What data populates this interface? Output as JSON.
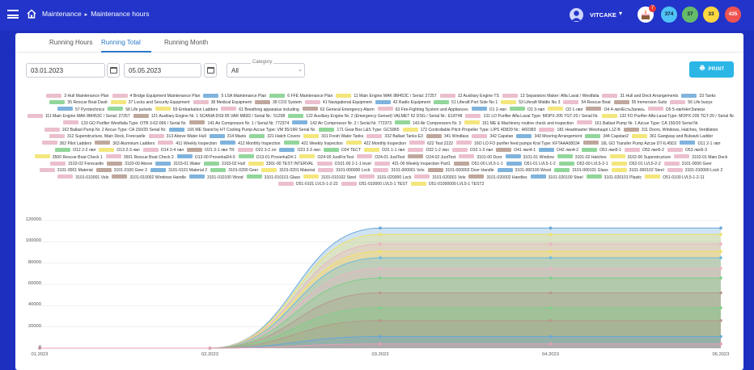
{
  "breadcrumb": {
    "section": "Maintenance",
    "separator": "▸",
    "page": "Maintenance hours"
  },
  "user": {
    "name": "VITCAKE",
    "cake_badge": "7"
  },
  "counters": [
    {
      "value": "374",
      "bg": "#4fc3f7",
      "fg": "#123"
    },
    {
      "value": "37",
      "bg": "#66bb6a",
      "fg": "#123"
    },
    {
      "value": "33",
      "bg": "#ffd740",
      "fg": "#123"
    },
    {
      "value": "435",
      "bg": "#ef5350",
      "fg": "#fff"
    }
  ],
  "tabs": [
    "Running Hours",
    "Running Total",
    "Running Month"
  ],
  "active_tab": "Running Total",
  "filters": {
    "date_from": "03.01.2023",
    "date_to": "05.05.2023",
    "category_label": "Category",
    "category_value": "All"
  },
  "print_label": "PRINT",
  "colors": {
    "topbar": "#2234c9",
    "accent": "#2a78c8",
    "print": "#2bb6e6"
  },
  "chart_data": {
    "type": "area",
    "x": [
      "01.2023",
      "02.2023",
      "03.2023",
      "04.2023",
      "05.2023"
    ],
    "ylim": [
      0,
      120000
    ],
    "yticks": [
      "120000",
      "100000",
      "80000",
      "60000",
      "40000",
      "20000",
      "0"
    ],
    "series_shown": [
      {
        "values": [
          0,
          0,
          113000,
          113000,
          113000
        ],
        "color": "#6aa7d8"
      },
      {
        "values": [
          0,
          0,
          107000,
          107000,
          107000
        ],
        "color": "#f2e266"
      },
      {
        "values": [
          0,
          0,
          98000,
          98000,
          98000
        ],
        "color": "#e8b4c4"
      },
      {
        "values": [
          0,
          0,
          91000,
          91000,
          91000
        ],
        "color": "#f2e266"
      },
      {
        "values": [
          0,
          0,
          85000,
          85000,
          85000
        ],
        "color": "#6bbce0"
      },
      {
        "values": [
          0,
          0,
          75000,
          75000,
          75000
        ],
        "color": "#e8b4c4"
      },
      {
        "values": [
          0,
          0,
          66000,
          66000,
          66000
        ],
        "color": "#7fd08a"
      },
      {
        "values": [
          0,
          0,
          52000,
          52000,
          52000
        ],
        "color": "#b59a8c"
      },
      {
        "values": [
          0,
          0,
          38000,
          38000,
          38000
        ],
        "color": "#7fd08a"
      },
      {
        "values": [
          0,
          0,
          26000,
          26000,
          26000
        ],
        "color": "#b59a8c"
      },
      {
        "values": [
          0,
          0,
          11000,
          11000,
          11000
        ],
        "color": "#6aa7d8"
      },
      {
        "values": [
          0,
          0,
          4000,
          4000,
          4000
        ],
        "color": "#e8a0b4"
      }
    ],
    "legend": [
      {
        "label": "3 Hull Maintenance Plan",
        "color": "#e8b4c4"
      },
      {
        "label": "4 Bridge Equipment Maintenance Plan",
        "color": "#e8b4c4"
      },
      {
        "label": "5 LSA Maintenance Plan",
        "color": "#6aa7d8"
      },
      {
        "label": "6 FFE Maintenance Plan",
        "color": "#7fd08a"
      },
      {
        "label": "11 Main Engine MAK 8M453C / Serial: 27257",
        "color": "#f2e266"
      },
      {
        "label": "12 Auxiliary Engine TS",
        "color": "#e8b4c4"
      },
      {
        "label": "13 Separators Maker: Alfa Laval / Westfalia",
        "color": "#e8b4c4"
      },
      {
        "label": "31 Hull and Deck Arrangements",
        "color": "#e8b4c4"
      },
      {
        "label": "33 Tanks",
        "color": "#6aa7d8"
      },
      {
        "label": "35 Rescue Boat Davit",
        "color": "#7fd08a"
      },
      {
        "label": "37 Locks and Security Equipment",
        "color": "#f2e266"
      },
      {
        "label": "38 Medical Equipment",
        "color": "#e8b4c4"
      },
      {
        "label": "39 CO2 System",
        "color": "#b59a8c"
      },
      {
        "label": "41 Navigational Equipment",
        "color": "#e8b4c4"
      },
      {
        "label": "42 Radio Equipment",
        "color": "#6aa7d8"
      },
      {
        "label": "51 Liferaft Port Side No 1",
        "color": "#7fd08a"
      },
      {
        "label": "53 Liferaft Middle No 3",
        "color": "#f2e266"
      },
      {
        "label": "54 Rescue Boat",
        "color": "#e8b4c4"
      },
      {
        "label": "55 Immersion Suits",
        "color": "#b59a8c"
      },
      {
        "label": "56 Life buoys",
        "color": "#e8b4c4"
      },
      {
        "label": "57 Pyrotechnics",
        "color": "#6aa7d8"
      },
      {
        "label": "58 Life jackets",
        "color": "#7fd08a"
      },
      {
        "label": "59 Embarkation Ladders",
        "color": "#f2e266"
      },
      {
        "label": "61 Breathing apparatus including",
        "color": "#e8b4c4"
      },
      {
        "label": "62 General Emergency Alarm",
        "color": "#b59a8c"
      },
      {
        "label": "63 Fire-Fighting System and Appliances",
        "color": "#e8b4c4"
      },
      {
        "label": "O1 2-лвл",
        "color": "#6aa7d8"
      },
      {
        "label": "O2 3-лвл",
        "color": "#7fd08a"
      },
      {
        "label": "O3 1-лвл",
        "color": "#f2e266"
      },
      {
        "label": "O4 4-лвл\\ЕстьЗапись",
        "color": "#b59a8c"
      },
      {
        "label": "O5 5-лвл\\НетЗаписи",
        "color": "#e8b4c4"
      },
      {
        "label": "111 Main Engine MAK 8M453C / Serial: 27257",
        "color": "#e8b4c4"
      },
      {
        "label": "121 Auxiliary Engine Nr. 1 SCANIA DS9 85 VAR M83D / Serial Nr.: 51208",
        "color": "#b59a8c"
      },
      {
        "label": "122 Auxiliary Engine Nr. 2 (Emergency Genset) VALMET 62 DSG / Serial Nr.: E18748",
        "color": "#7fd08a"
      },
      {
        "label": "131 LO Purifier Alfa-Laval Type: MOPX-205 TGT-20 / Serial Nr.",
        "color": "#e8b4c4"
      },
      {
        "label": "132 FO Purifier Alfa-Laval Type: MOPX-205 TGT-20 / Serial Nr.",
        "color": "#f2e266"
      },
      {
        "label": "133 GO Purifier Westfalia Type: OTB 3-02-066 / Serial Nr.",
        "color": "#e8b4c4"
      },
      {
        "label": "141 Air Compressor Nr. 1 / Serial Nr. 772374",
        "color": "#b59a8c"
      },
      {
        "label": "142 Air Compressor Nr. 2 / Serial Nr. 772373",
        "color": "#6aa7d8"
      },
      {
        "label": "143 Air Compressors Nr. 3",
        "color": "#7fd08a"
      },
      {
        "label": "151 ME & Machinery routine check and inspection",
        "color": "#f2e266"
      },
      {
        "label": "161 Ballast Pump Nr. 1 Azcue Type: CA 150/20 Serial Nr.",
        "color": "#e8b4c4"
      },
      {
        "label": "162 Ballast Pump Nr. 2 Azcue Type: CA 150/20 Serial Nr.",
        "color": "#e8b4c4"
      },
      {
        "label": "166 ME Stand by HT Cooling Pump Azcue Type: VM 55/16R Serial Nr.",
        "color": "#6aa7d8"
      },
      {
        "label": "171 Gear Box L&S Type: GCS865",
        "color": "#7fd08a"
      },
      {
        "label": "172 Controllable Pitch Propeller Type: LIPS 4D829 Nr.: H60383",
        "color": "#f2e266"
      },
      {
        "label": "181 Headmaster Weishaupt L1Z-B",
        "color": "#e8b4c4"
      },
      {
        "label": "311 Doors, Windows, Hatches, Ventilation",
        "color": "#b59a8c"
      },
      {
        "label": "312 Superstructure, Main Deck, Forecastle",
        "color": "#e8b4c4"
      },
      {
        "label": "313 Above Water Hull",
        "color": "#e8b4c4"
      },
      {
        "label": "314 Masts",
        "color": "#6aa7d8"
      },
      {
        "label": "321 Hatch Covers",
        "color": "#7fd08a"
      },
      {
        "label": "331 Fresh Water Tanks",
        "color": "#f2e266"
      },
      {
        "label": "332 Ballast Tanks E3",
        "color": "#e8b4c4"
      },
      {
        "label": "341 Windlass",
        "color": "#b59a8c"
      },
      {
        "label": "342 Capstan",
        "color": "#e8b4c4"
      },
      {
        "label": "343 Mooring Arrangement",
        "color": "#6aa7d8"
      },
      {
        "label": "344 Capstan2",
        "color": "#7fd08a"
      },
      {
        "label": "361 Gangway and Bulwark Ladder",
        "color": "#f2e266"
      },
      {
        "label": "362 Pilot Ladders",
        "color": "#e8b4c4"
      },
      {
        "label": "363 Aluminum Ladders",
        "color": "#b59a8c"
      },
      {
        "label": "411 Weekly Inspection",
        "color": "#e8b4c4"
      },
      {
        "label": "412 Monthly Inspection",
        "color": "#6aa7d8"
      },
      {
        "label": "421 Weekly Inspection",
        "color": "#7fd08a"
      },
      {
        "label": "422 Monthly Inspection",
        "color": "#f2e266"
      },
      {
        "label": "622 Test 2222",
        "color": "#e8b4c4"
      },
      {
        "label": "16O LO FO purifier feed pumps Kral Type: KFTAAA08034",
        "color": "#e8b4c4"
      },
      {
        "label": "16L GO Transfer Pump Azcue DT-IL45D2",
        "color": "#b59a8c"
      },
      {
        "label": "O11 2-1 лвл",
        "color": "#6aa7d8"
      },
      {
        "label": "O12 2-2 лвл",
        "color": "#7fd08a"
      },
      {
        "label": "O13 2-3 лвл",
        "color": "#f2e266"
      },
      {
        "label": "O14 2-4 лвл",
        "color": "#e8b4c4"
      },
      {
        "label": "O21 3-1 лвл TR",
        "color": "#b59a8c"
      },
      {
        "label": "O22 3-2 лл",
        "color": "#e8b4c4"
      },
      {
        "label": "O23 3-3 лвл",
        "color": "#6aa7d8"
      },
      {
        "label": "O24 TECT",
        "color": "#7fd08a"
      },
      {
        "label": "O31 1-1 лвл",
        "color": "#f2e266"
      },
      {
        "label": "O32 1-2 лвл",
        "color": "#e8b4c4"
      },
      {
        "label": "O33 1-3 лвл",
        "color": "#e8b4c4"
      },
      {
        "label": "O41 лвл4-1",
        "color": "#b59a8c"
      },
      {
        "label": "O42 лвл4-2",
        "color": "#6aa7d8"
      },
      {
        "label": "O51 лвл5-1",
        "color": "#7fd08a"
      },
      {
        "label": "O52 лвл5-2",
        "color": "#e8b4c4"
      },
      {
        "label": "O53 лвл5-3",
        "color": "#e8b4c4"
      },
      {
        "label": "3500 Rescue Boat Check 1",
        "color": "#f2e266"
      },
      {
        "label": "3501 Rescue Boat Check 2",
        "color": "#e8b4c4"
      },
      {
        "label": "O13-00 ProverkaD4-0",
        "color": "#6aa7d8"
      },
      {
        "label": "O13-01 ProverkaD4-1",
        "color": "#7fd08a"
      },
      {
        "label": "O24-00 JustForTest",
        "color": "#f2e266"
      },
      {
        "label": "O24-01 JustTest",
        "color": "#e8b4c4"
      },
      {
        "label": "O24-02 JustTest",
        "color": "#b59a8c"
      },
      {
        "label": "3101-00 Door",
        "color": "#e8b4c4"
      },
      {
        "label": "3101-01 Window",
        "color": "#6aa7d8"
      },
      {
        "label": "3101-02 Hatches",
        "color": "#7fd08a"
      },
      {
        "label": "3102-00 Superstructure",
        "color": "#f2e266"
      },
      {
        "label": "3102-01 Main Deck",
        "color": "#e8b4c4"
      },
      {
        "label": "3102-02 Forecastle",
        "color": "#e8b4c4"
      },
      {
        "label": "3103-00 Above",
        "color": "#b59a8c"
      },
      {
        "label": "3103-01 Water",
        "color": "#6aa7d8"
      },
      {
        "label": "3103-02 Hull",
        "color": "#7fd08a"
      },
      {
        "label": "3301-00 TEST INTERVAL",
        "color": "#f2e266"
      },
      {
        "label": "O101-00 2-1-1 level",
        "color": "#e8b4c4"
      },
      {
        "label": "421-00 Weekly Inspection Part1",
        "color": "#e8b4c4"
      },
      {
        "label": "O51-00 LVL5-1-1",
        "color": "#b59a8c"
      },
      {
        "label": "O51-01 LVL5-1-2",
        "color": "#6aa7d8"
      },
      {
        "label": "O52-00 LVL5-2-1",
        "color": "#7fd08a"
      },
      {
        "label": "O52-01 LVL5-2-2",
        "color": "#f2e266"
      },
      {
        "label": "3101-0000 Geer",
        "color": "#e8b4c4"
      },
      {
        "label": "3101-0001 Material",
        "color": "#e8b4c4"
      },
      {
        "label": "3101-0100 Geer 2",
        "color": "#b59a8c"
      },
      {
        "label": "3101-0101 Material 2",
        "color": "#6aa7d8"
      },
      {
        "label": "3101-0200 Geer",
        "color": "#7fd08a"
      },
      {
        "label": "3101-0201 Material",
        "color": "#f2e266"
      },
      {
        "label": "3101-000000 Lock",
        "color": "#e8b4c4"
      },
      {
        "label": "3101-000001 Vels",
        "color": "#e8b4c4"
      },
      {
        "label": "3101-000002 Door Handle",
        "color": "#b59a8c"
      },
      {
        "label": "3101-000100 Wood",
        "color": "#6aa7d8"
      },
      {
        "label": "3101-000101 Glass",
        "color": "#7fd08a"
      },
      {
        "label": "3101-000102 Steel",
        "color": "#f2e266"
      },
      {
        "label": "3101-010000 Lock 2",
        "color": "#e8b4c4"
      },
      {
        "label": "3101-010001 Vels",
        "color": "#e8b4c4"
      },
      {
        "label": "3101-010002 Windows Handle",
        "color": "#b59a8c"
      },
      {
        "label": "3101-010100 Wood",
        "color": "#6aa7d8"
      },
      {
        "label": "3101-010101 Glass",
        "color": "#7fd08a"
      },
      {
        "label": "3101-010102 Steel",
        "color": "#f2e266"
      },
      {
        "label": "3101-020000 Lock",
        "color": "#e8b4c4"
      },
      {
        "label": "3101-020001 Vels",
        "color": "#e8b4c4"
      },
      {
        "label": "3101-020002 Handles",
        "color": "#b59a8c"
      },
      {
        "label": "3101-020100 Steel",
        "color": "#6aa7d8"
      },
      {
        "label": "3101-020101 Plastic",
        "color": "#7fd08a"
      },
      {
        "label": "O51-0100 LVL5-1-2-11",
        "color": "#f2e266"
      },
      {
        "label": "O51-0101 LVL5-1-2-22",
        "color": "#e8b4c4"
      },
      {
        "label": "O51-010000 LVL5-1 TEST",
        "color": "#e8b4c4"
      },
      {
        "label": "O51-01000000 LVL5-1 TEST2",
        "color": "#f2e266"
      }
    ]
  }
}
